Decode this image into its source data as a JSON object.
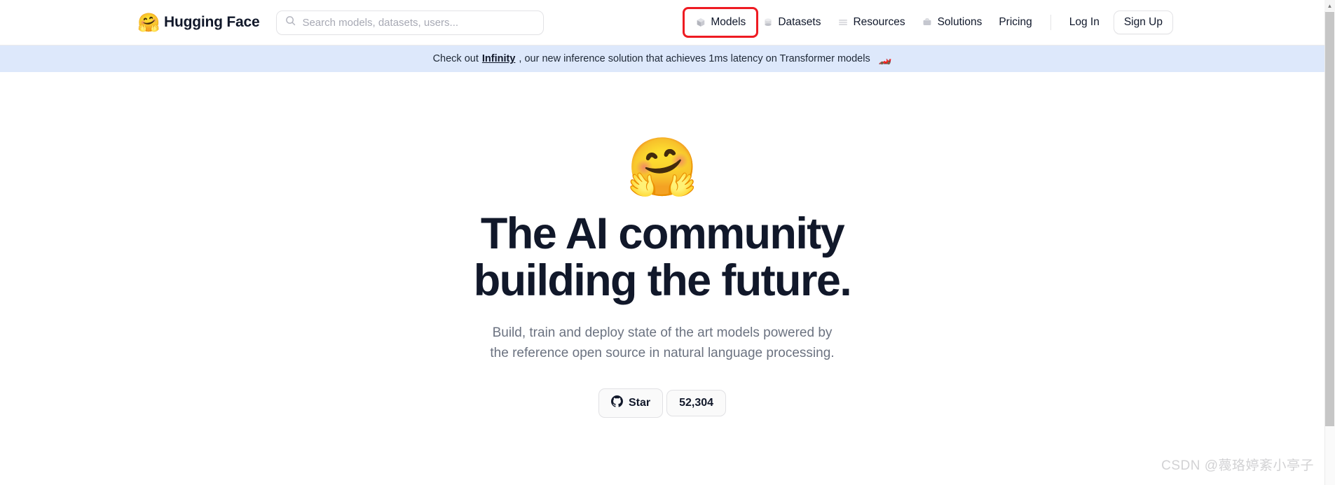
{
  "header": {
    "brand": {
      "logo_icon": "hugging-face-emoji",
      "logo_glyph": "🤗",
      "name": "Hugging Face"
    },
    "search": {
      "icon": "search-icon",
      "placeholder": "Search models, datasets, users...",
      "value": ""
    },
    "nav_items": [
      {
        "label": "Models",
        "icon": "cube-icon",
        "icon_glyph": "📦",
        "highlighted": true
      },
      {
        "label": "Datasets",
        "icon": "database-icon",
        "icon_glyph": "🗃",
        "highlighted": false
      },
      {
        "label": "Resources",
        "icon": "menu-lines-icon",
        "icon_glyph": "≡",
        "highlighted": false
      },
      {
        "label": "Solutions",
        "icon": "briefcase-icon",
        "icon_glyph": "💼",
        "highlighted": false
      },
      {
        "label": "Pricing",
        "icon": "none",
        "icon_glyph": "",
        "highlighted": false
      }
    ],
    "login_label": "Log In",
    "signup_label": "Sign Up",
    "highlight_color": "#ee1b22"
  },
  "banner": {
    "prefix": "Check out ",
    "link_text": "Infinity",
    "suffix": ", our new inference solution that achieves 1ms latency on Transformer models",
    "emoji": "🏎️",
    "emoji_name": "racing-car-emoji",
    "background_color": "#dde8fb"
  },
  "hero": {
    "logo_icon": "hugging-face-emoji",
    "logo_glyph": "🤗",
    "title_line_1": "The AI community",
    "title_line_2": "building the future.",
    "subtitle_line_1": "Build, train and deploy state of the art models powered by",
    "subtitle_line_2": "the reference open source in natural language processing.",
    "title_color": "#11182a",
    "subtitle_color": "#6b7280"
  },
  "github": {
    "icon": "github-icon",
    "star_label": "Star",
    "star_count": "52,304"
  },
  "scrollbar": {
    "up_arrow": "▲"
  },
  "watermark": {
    "text": "CSDN @薎珞婷紊小亭子"
  }
}
